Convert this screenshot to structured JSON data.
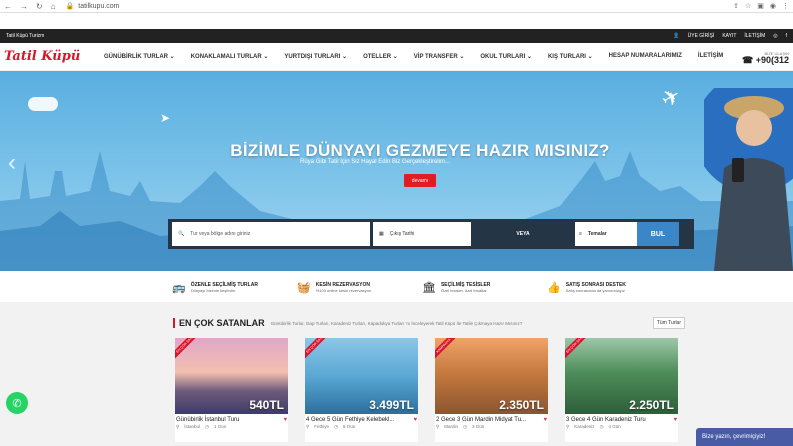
{
  "browser": {
    "url": "tatilkupu.com"
  },
  "topbar": {
    "left": "Tatil Küpü Turizm",
    "right": [
      "ÜYE GİRİŞİ",
      "KAYIT",
      "İLETİŞİM"
    ]
  },
  "logo": "Tatil Küpü",
  "nav": {
    "items": [
      "GÜNÜBİRLİK TURLAR ⌄",
      "KONAKLAMALI TURLAR ⌄",
      "YURTDIŞI TURLARI ⌄",
      "OTELLER ⌄",
      "VİP TRANSFER ⌄",
      "OKUL TURLARI ⌄",
      "KIŞ TURLARI ⌄",
      "HESAP NUMARALARIMIZ",
      "İLETİŞİM"
    ],
    "phone_label": "BİZE ULAŞIN",
    "phone": "+90(312"
  },
  "hero": {
    "title": "BİZİMLE DÜNYAYI GEZMEYE HAZIR MISINIZ?",
    "subtitle": "Rüya Gibi Tatil İçin Siz Hayal Edin Biz Gerçekleştirelim...",
    "button": "devamı"
  },
  "search": {
    "placeholder": "Tur veya bölge adını giriniz",
    "date": "Çıkış Tarihi",
    "or": "VEYA",
    "theme": "Temalar",
    "submit": "BUL"
  },
  "features": [
    {
      "title": "ÖZENLE SEÇİLMİŞ TURLAR",
      "desc": "Dünyayı bizimle keşfedin"
    },
    {
      "title": "KESİN REZERVASYON",
      "desc": "%100 online kesin rezervasyon"
    },
    {
      "title": "SEÇİLMİŞ TESİSLER",
      "desc": "Özel tesisler, özel fırsatlar"
    },
    {
      "title": "SATIŞ SONRASI DESTEK",
      "desc": "Satış sonrasında da yanınızdayız"
    }
  ],
  "bestsellers": {
    "title": "EN ÇOK SATANLAR",
    "desc": "Günübirlik Turlar, Gap Turları, Karadeniz Turları, Kapadokya Turları 'nı İnceleyerek Tatil Küpü İle Tatile Çıkmaya Hazır Mısınız?",
    "all": "Tüm Turlar",
    "cards": [
      {
        "ribbon": "EN ÇOK SATAN",
        "price": "540TL",
        "title": "Günübirlik İstanbul Turu",
        "place": "İstanbul",
        "duration": "1 Gün"
      },
      {
        "ribbon": "EN ÇOK SATAN",
        "price": "3.499TL",
        "title": "4 Gece 5 Gün Fethiye Kelebekl...",
        "place": "Fethiye",
        "duration": "5 Gün"
      },
      {
        "ribbon": "KAMPANYA",
        "price": "2.350TL",
        "title": "2 Gece 3 Gün Mardin Midyat Tu...",
        "place": "Mardin",
        "duration": "3 Gün"
      },
      {
        "ribbon": "EN ÇOK SATAN",
        "price": "2.250TL",
        "title": "3 Gece 4 Gün Karadeniz Turu",
        "place": "Karadeniz",
        "duration": "4 Gün"
      }
    ]
  },
  "chat": "Bize yazın, çevrimiçiyiz!"
}
